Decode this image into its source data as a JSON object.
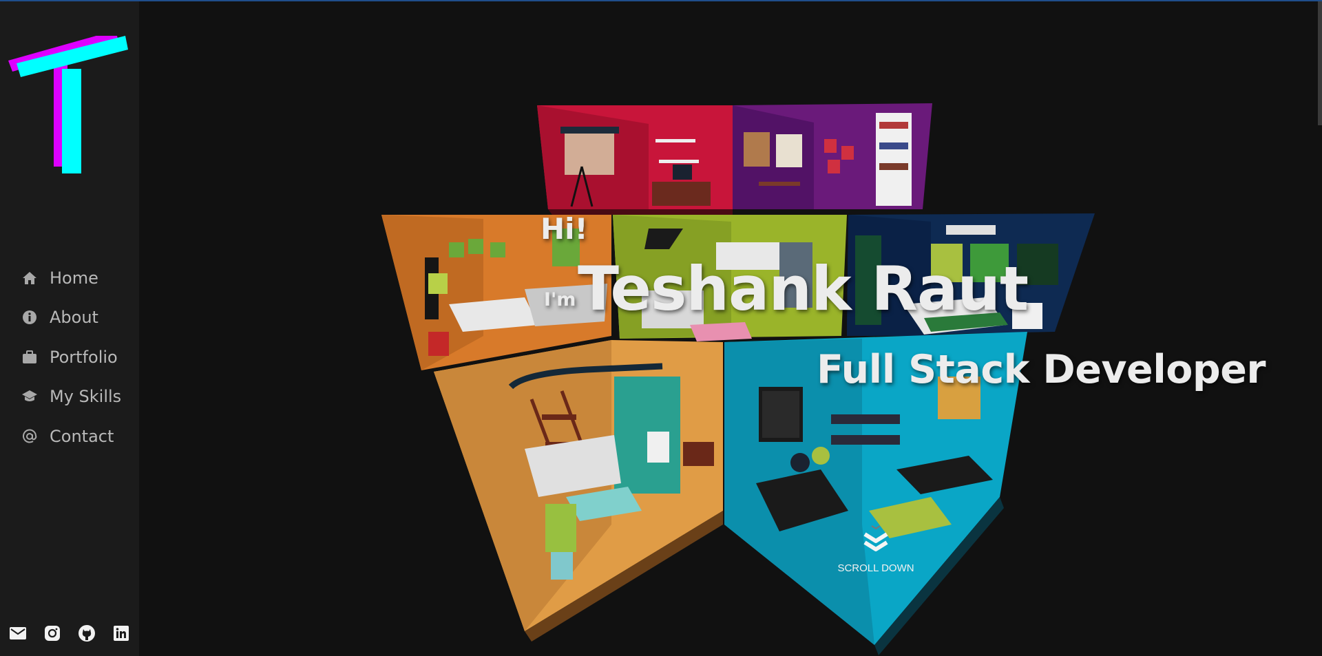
{
  "brand": {
    "logo_letter": "T",
    "colors": {
      "primary": "#00ffff",
      "shadow": "#dd00ff"
    }
  },
  "nav": {
    "items": [
      {
        "label": "Home",
        "icon": "home-icon"
      },
      {
        "label": "About",
        "icon": "info-icon"
      },
      {
        "label": "Portfolio",
        "icon": "briefcase-icon"
      },
      {
        "label": "My Skills",
        "icon": "graduation-cap-icon"
      },
      {
        "label": "Contact",
        "icon": "at-icon"
      }
    ]
  },
  "socials": [
    {
      "icon": "mail-icon"
    },
    {
      "icon": "instagram-icon"
    },
    {
      "icon": "github-icon"
    },
    {
      "icon": "linkedin-icon"
    }
  ],
  "hero": {
    "greeting": "Hi!",
    "intro": "I'm",
    "name": "Teshank Raut",
    "role": "Full Stack Developer",
    "scroll_label": "SCROLL DOWN"
  },
  "colors": {
    "background": "#111111",
    "sidebar": "#1b1b1b",
    "text": "#ececec",
    "nav_text": "#b9b9b9"
  }
}
